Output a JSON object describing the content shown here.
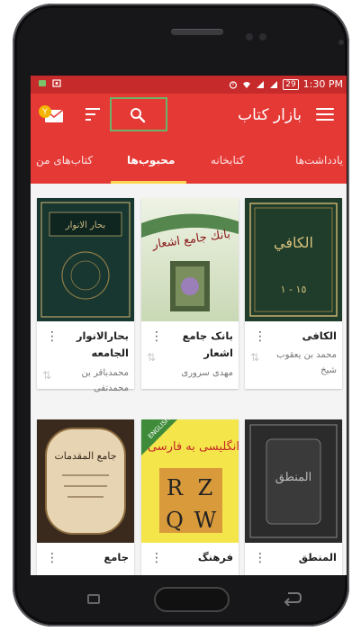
{
  "status_bar": {
    "time": "1:30 PM",
    "battery": "29"
  },
  "app_bar": {
    "title": "بازار کتاب",
    "notification_badge": "Y"
  },
  "tabs": [
    {
      "label": "یادداشت‌ها"
    },
    {
      "label": "کتابخانه"
    },
    {
      "label": "محبوب‌ها"
    },
    {
      "label": "کتاب‌های من"
    }
  ],
  "books": [
    {
      "title": "الکافی",
      "author": "محمد بن يعقوب شيخ",
      "cover_text": "الكافي",
      "cover_sub": "١٥ - ١"
    },
    {
      "title": "بانک جامع اشعار",
      "author": "مهدی سروری",
      "cover_text": "بانك جامع اشعار"
    },
    {
      "title": "بحارالانوار الجامعه",
      "author": "محمدباقر بن محمدتقی",
      "cover_text": "بحار الانوار"
    },
    {
      "title": "المنطق",
      "author": "",
      "cover_text": "المنطق"
    },
    {
      "title": "فرهنگ",
      "author": "",
      "cover_text": "انگلیسی به فارسی",
      "cover_sub": "ENGLISH",
      "cover_letters": [
        "R",
        "Z",
        "Q",
        "W"
      ]
    },
    {
      "title": "جامع",
      "author": "",
      "cover_text": "جامع المقدمات"
    }
  ],
  "colors": {
    "appbar": "#e53935",
    "statusbar": "#c62a2a",
    "indicator": "#ffd54f",
    "highlight": "#6db36b"
  }
}
